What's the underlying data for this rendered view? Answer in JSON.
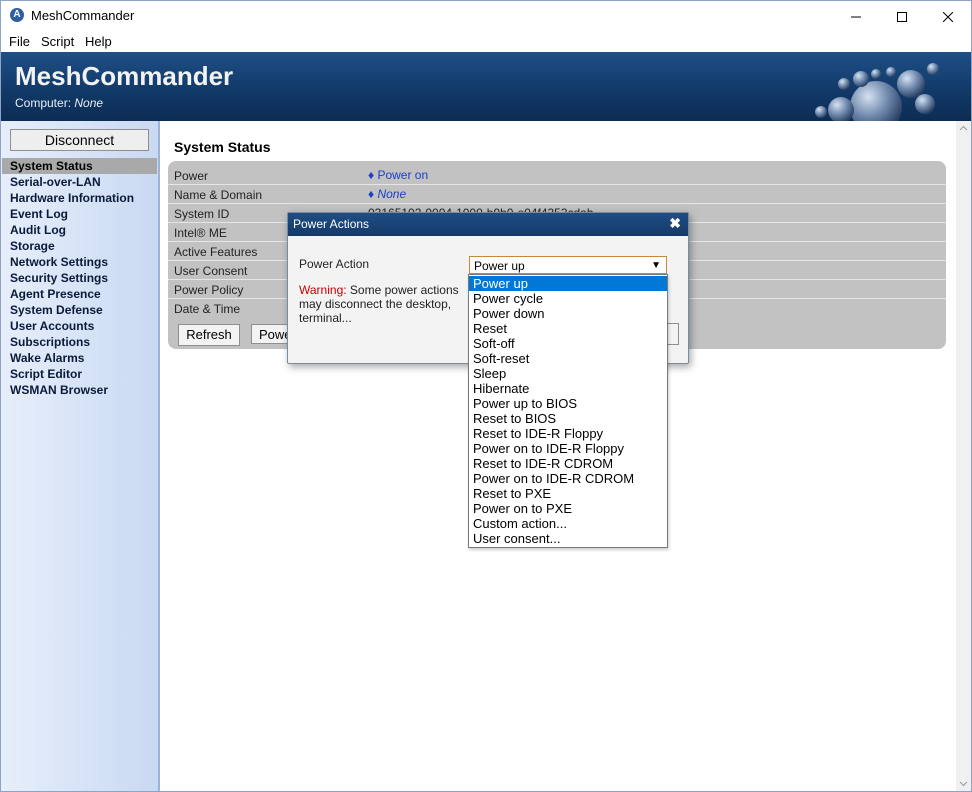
{
  "window": {
    "title": "MeshCommander"
  },
  "menu": [
    "File",
    "Script",
    "Help"
  ],
  "banner": {
    "title": "MeshCommander",
    "computer_label": "Computer:",
    "computer_value": "None"
  },
  "sidebar": {
    "disconnect_label": "Disconnect",
    "items": [
      {
        "label": "System Status",
        "active": true
      },
      {
        "label": "Serial-over-LAN"
      },
      {
        "label": "Hardware Information"
      },
      {
        "label": "Event Log"
      },
      {
        "label": "Audit Log"
      },
      {
        "label": "Storage"
      },
      {
        "label": "Network Settings"
      },
      {
        "label": "Security Settings"
      },
      {
        "label": "Agent Presence"
      },
      {
        "label": "System Defense"
      },
      {
        "label": "User Accounts"
      },
      {
        "label": "Subscriptions"
      },
      {
        "label": "Wake Alarms"
      },
      {
        "label": "Script Editor"
      },
      {
        "label": "WSMAN Browser"
      }
    ]
  },
  "main": {
    "title": "System Status",
    "rows": [
      {
        "label": "Power",
        "value": "♦ Power on"
      },
      {
        "label": "Name & Domain",
        "value": "♦ None"
      },
      {
        "label": "System ID",
        "value": "03165102-0004-1000-b9b0-e04f4353cdab"
      },
      {
        "label": "Intel® ME",
        "value": ""
      },
      {
        "label": "Active Features",
        "value": ""
      },
      {
        "label": "User Consent",
        "value": ""
      },
      {
        "label": "Power Policy",
        "value": ""
      },
      {
        "label": "Date & Time",
        "value": ""
      }
    ],
    "buttons": {
      "refresh": "Refresh",
      "power": "Power Actions..."
    }
  },
  "dialog": {
    "title": "Power Actions",
    "close_glyph": "✖",
    "field_label": "Power Action",
    "selected": "Power up",
    "warning_prefix": "Warning:",
    "warning_text": "Some power actions may disconnect the desktop, terminal...",
    "options": [
      "Power up",
      "Power cycle",
      "Power down",
      "Reset",
      "Soft-off",
      "Soft-reset",
      "Sleep",
      "Hibernate",
      "Power up to BIOS",
      "Reset to BIOS",
      "Reset to IDE-R Floppy",
      "Power on to IDE-R Floppy",
      "Reset to IDE-R CDROM",
      "Power on to IDE-R CDROM",
      "Reset to PXE",
      "Power on to PXE",
      "Custom action...",
      "User consent..."
    ]
  },
  "colors": {
    "accent": "#0078d7",
    "banner": "#123a69",
    "link": "#1a3fc8",
    "warning": "#cc0000"
  }
}
